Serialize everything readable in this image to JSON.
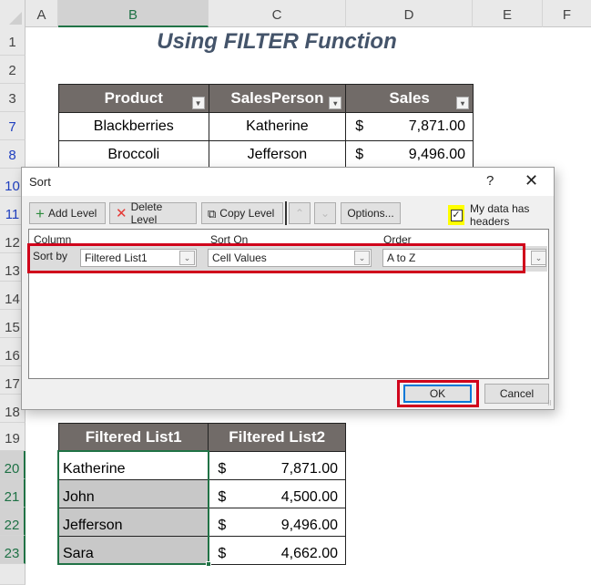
{
  "sheet": {
    "columns": [
      "A",
      "B",
      "C",
      "D",
      "E",
      "F"
    ],
    "selected_column": "B",
    "rows_visible": [
      "1",
      "2",
      "3",
      "7",
      "8",
      "10",
      "11",
      "12",
      "13",
      "14",
      "15",
      "16",
      "17",
      "18",
      "19",
      "20",
      "21",
      "22",
      "23"
    ],
    "title": "Using FILTER Function"
  },
  "source_table": {
    "headers": [
      "Product",
      "SalesPerson",
      "Sales"
    ],
    "row_numbers": [
      "7",
      "8"
    ],
    "rows": [
      {
        "product": "Blackberries",
        "salesperson": "Katherine",
        "currency": "$",
        "sales": "7,871.00"
      },
      {
        "product": "Broccoli",
        "salesperson": "Jefferson",
        "currency": "$",
        "sales": "9,496.00"
      }
    ]
  },
  "result_table": {
    "headers": [
      "Filtered List1",
      "Filtered List2"
    ],
    "rows": [
      {
        "name": "Katherine",
        "currency": "$",
        "value": "7,871.00"
      },
      {
        "name": "John",
        "currency": "$",
        "value": "4,500.00"
      },
      {
        "name": "Jefferson",
        "currency": "$",
        "value": "9,496.00"
      },
      {
        "name": "Sara",
        "currency": "$",
        "value": "4,662.00"
      }
    ]
  },
  "sort_dialog": {
    "title": "Sort",
    "help": "?",
    "close": "✕",
    "toolbar": {
      "add_level": "Add Level",
      "delete_level": "Delete Level",
      "copy_level": "Copy Level",
      "move_up": "⌃",
      "move_down": "⌄",
      "options": "Options..."
    },
    "my_data_has_headers": {
      "label": "My data has headers",
      "checked": true
    },
    "column_headers": {
      "column": "Column",
      "sort_on": "Sort On",
      "order": "Order"
    },
    "level": {
      "label": "Sort by",
      "column": "Filtered List1",
      "sort_on": "Cell Values",
      "order": "A to Z"
    },
    "ok": "OK",
    "cancel": "Cancel"
  },
  "colors": {
    "header_fill": "#716b68",
    "excel_green": "#217346",
    "highlight_red": "#d0021b",
    "highlight_yellow": "#ffff00",
    "title_color": "#44546a"
  }
}
